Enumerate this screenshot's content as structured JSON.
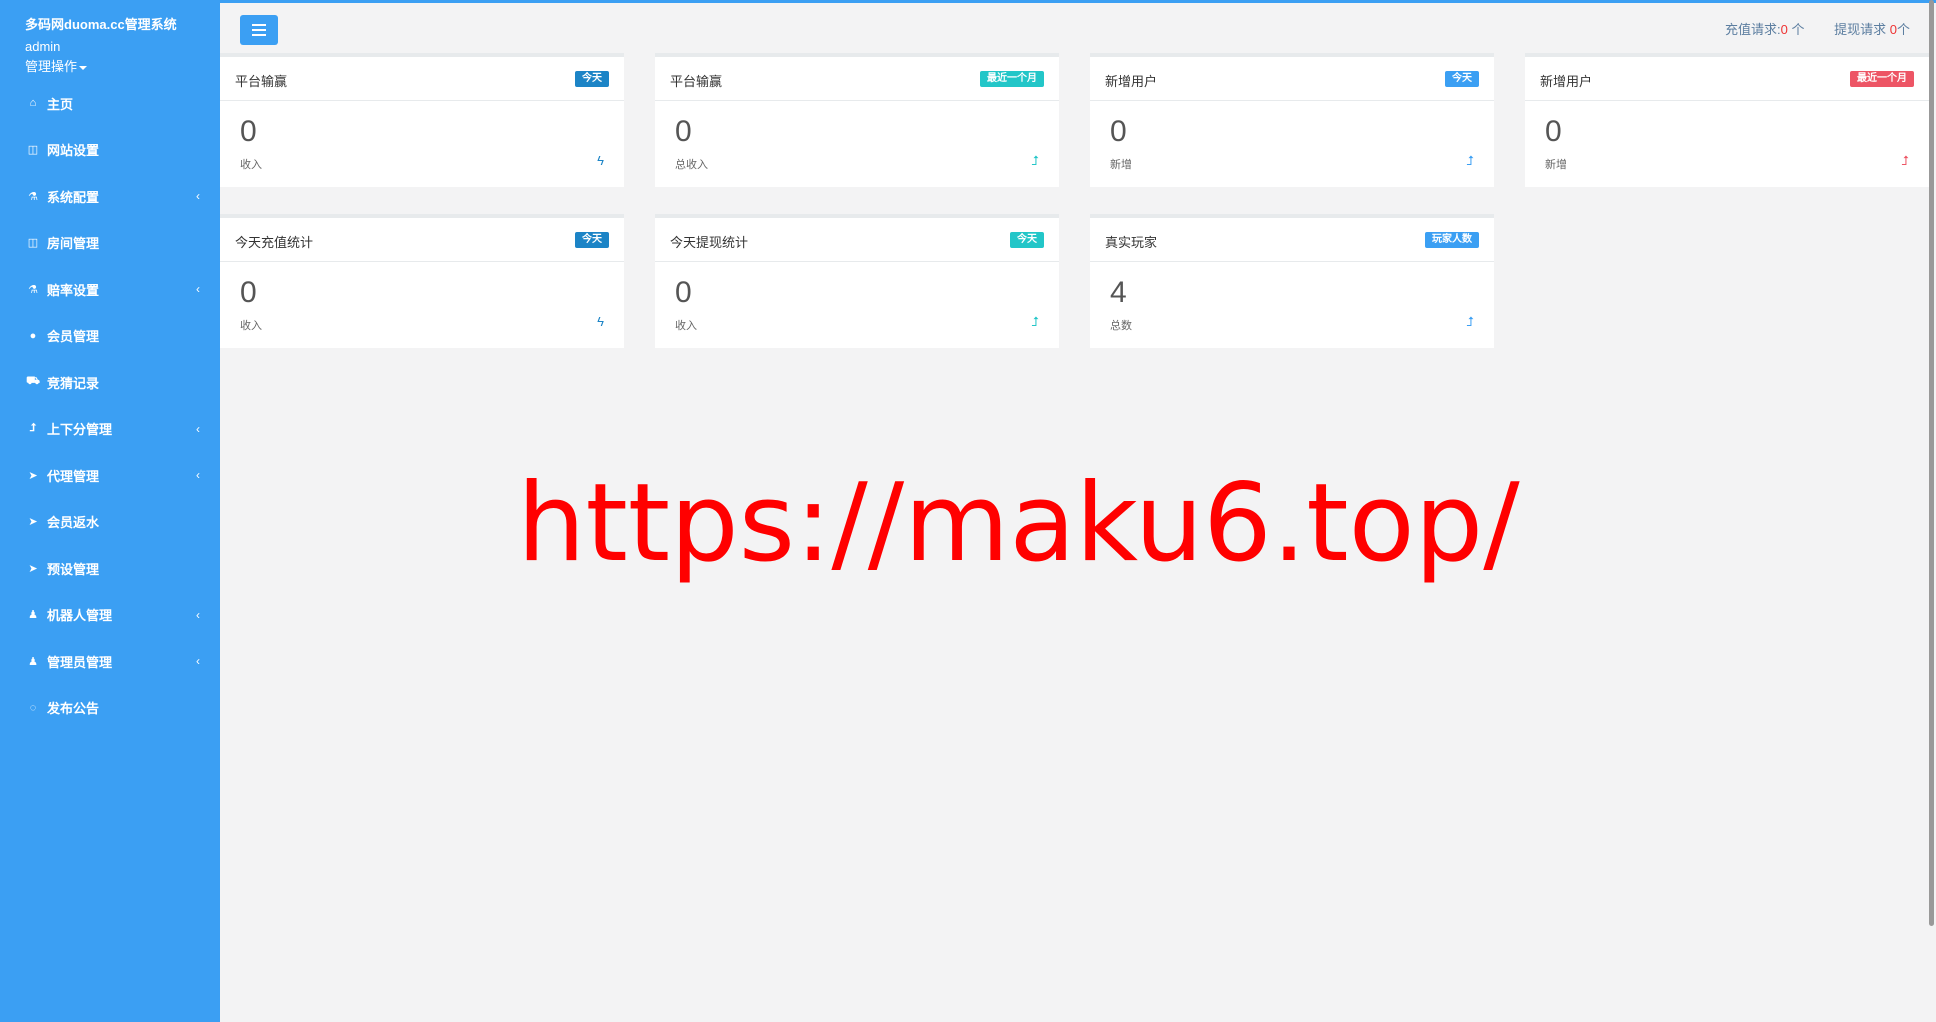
{
  "sidebar": {
    "brand": "多码网duoma.cc管理系统",
    "username": "admin",
    "ops_label": "管理操作",
    "items": [
      {
        "label": "主页",
        "icon": "home-icon",
        "glyph": "⌂",
        "expandable": false
      },
      {
        "label": "网站设置",
        "icon": "columns-icon",
        "glyph": "◫",
        "expandable": false
      },
      {
        "label": "系统配置",
        "icon": "flask-icon",
        "glyph": "⚗",
        "expandable": true
      },
      {
        "label": "房间管理",
        "icon": "columns-icon",
        "glyph": "◫",
        "expandable": false
      },
      {
        "label": "赔率设置",
        "icon": "flask-icon",
        "glyph": "⚗",
        "expandable": true
      },
      {
        "label": "会员管理",
        "icon": "user-icon",
        "glyph": "●",
        "expandable": false
      },
      {
        "label": "竞猜记录",
        "icon": "car-icon",
        "glyph": "⛟",
        "expandable": false
      },
      {
        "label": "上下分管理",
        "icon": "level-up-icon",
        "glyph": "⮥",
        "expandable": true
      },
      {
        "label": "代理管理",
        "icon": "paper-plane-icon",
        "glyph": "➤",
        "expandable": true
      },
      {
        "label": "会员返水",
        "icon": "paper-plane-icon",
        "glyph": "➤",
        "expandable": false
      },
      {
        "label": "预设管理",
        "icon": "paper-plane-icon",
        "glyph": "➤",
        "expandable": false
      },
      {
        "label": "机器人管理",
        "icon": "male-icon",
        "glyph": "♟",
        "expandable": true
      },
      {
        "label": "管理员管理",
        "icon": "male-icon",
        "glyph": "♟",
        "expandable": true
      },
      {
        "label": "发布公告",
        "icon": "comment-icon",
        "glyph": "◌",
        "expandable": false
      }
    ],
    "chevron": "‹"
  },
  "topbar": {
    "recharge_label": "充值请求:",
    "recharge_count": "0",
    "recharge_unit": " 个",
    "withdraw_label": "提现请求 ",
    "withdraw_count": "0",
    "withdraw_unit": "个"
  },
  "cards": [
    {
      "title": "平台输赢",
      "badge": "今天",
      "badge_color": "#1c84c6",
      "value": "0",
      "sub": "收入",
      "icon": "bolt-icon",
      "icon_glyph": "ϟ",
      "icon_color": "#1c84c6"
    },
    {
      "title": "平台输赢",
      "badge": "最近一个月",
      "badge_color": "#23c6c8",
      "value": "0",
      "sub": "总收入",
      "icon": "level-up-icon",
      "icon_glyph": "⮥",
      "icon_color": "#23c6c8"
    },
    {
      "title": "新增用户",
      "badge": "今天",
      "badge_color": "#3b9ff3",
      "value": "0",
      "sub": "新增",
      "icon": "level-up-icon",
      "icon_glyph": "⮥",
      "icon_color": "#3b9ff3"
    },
    {
      "title": "新增用户",
      "badge": "最近一个月",
      "badge_color": "#ed5565",
      "value": "0",
      "sub": "新增",
      "icon": "level-up-icon",
      "icon_glyph": "⮥",
      "icon_color": "#ed5565"
    },
    {
      "title": "今天充值统计",
      "badge": "今天",
      "badge_color": "#1c84c6",
      "value": "0",
      "sub": "收入",
      "icon": "bolt-icon",
      "icon_glyph": "ϟ",
      "icon_color": "#1c84c6"
    },
    {
      "title": "今天提现统计",
      "badge": "今天",
      "badge_color": "#23c6c8",
      "value": "0",
      "sub": "收入",
      "icon": "level-up-icon",
      "icon_glyph": "⮥",
      "icon_color": "#23c6c8"
    },
    {
      "title": "真实玩家",
      "badge": "玩家人数",
      "badge_color": "#3b9ff3",
      "value": "4",
      "sub": "总数",
      "icon": "level-up-icon",
      "icon_glyph": "⮥",
      "icon_color": "#3b9ff3"
    }
  ],
  "watermark": "https://maku6.top/",
  "colors": {
    "sidebar_bg": "#3b9ff3",
    "page_bg": "#f3f3f4",
    "accent_red": "#ee3333"
  }
}
